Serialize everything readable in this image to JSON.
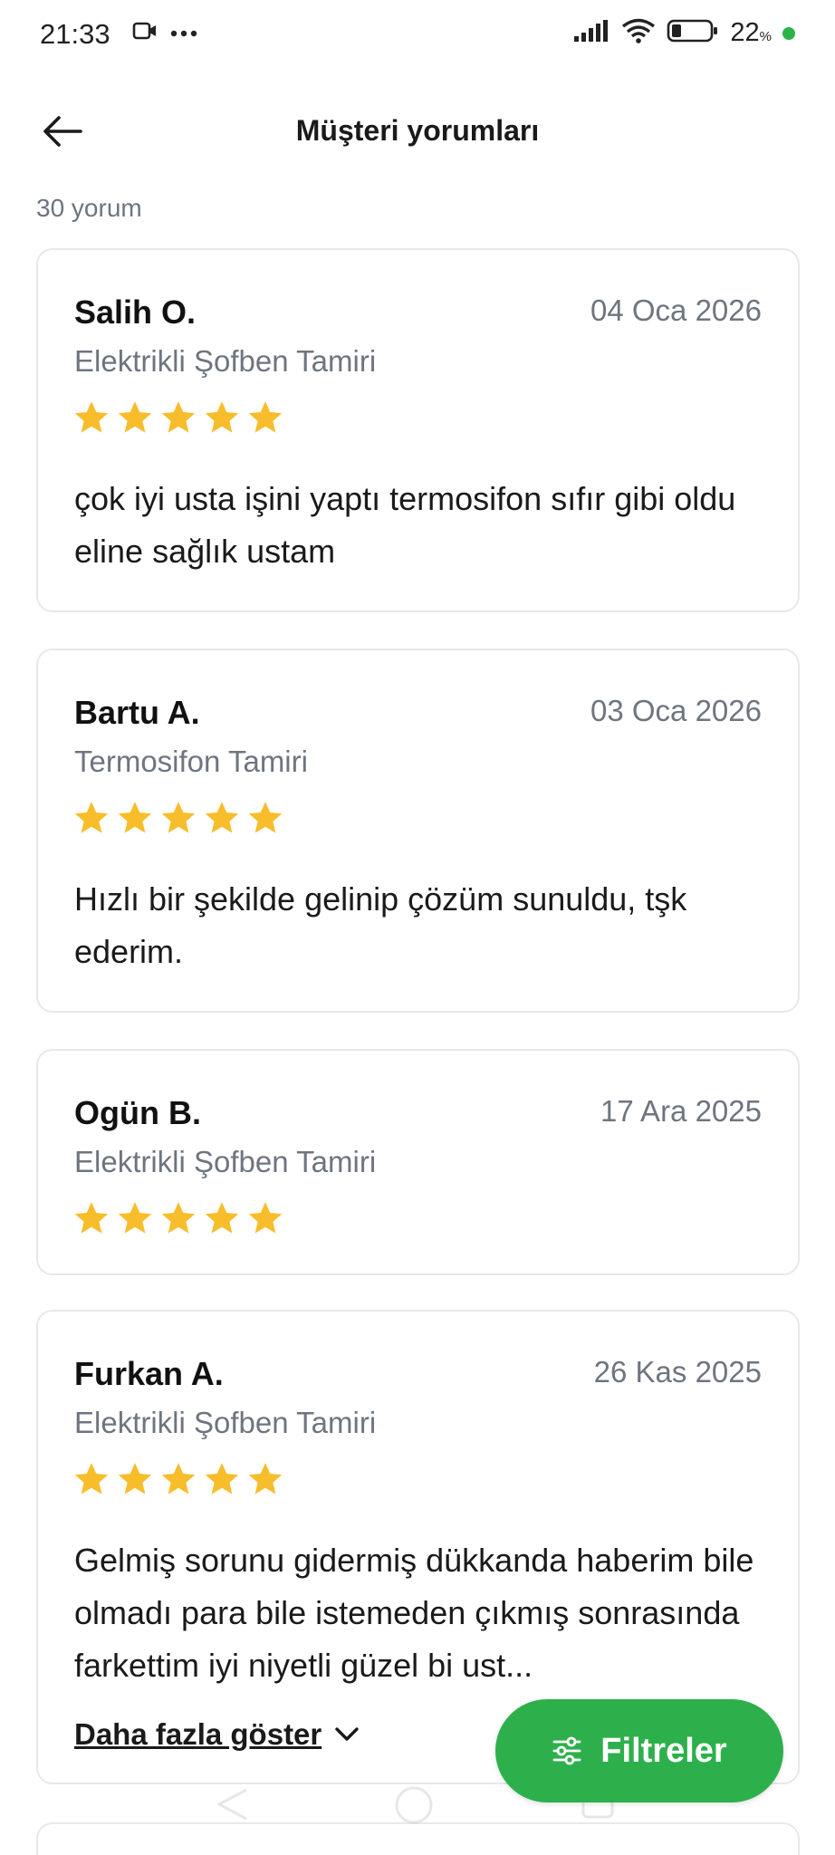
{
  "status_bar": {
    "time": "21:33",
    "battery_percent": "22",
    "battery_unit": "%",
    "battery_level": 0.22
  },
  "header": {
    "title": "Müşteri yorumları"
  },
  "summary": {
    "count_label": "30 yorum"
  },
  "reviews": [
    {
      "name": "Salih O.",
      "date": "04 Oca 2026",
      "service": "Elektrikli Şofben Tamiri",
      "rating": 5,
      "text": "çok iyi usta işini yaptı termosifon sıfır gibi oldu eline sağlık ustam"
    },
    {
      "name": "Bartu A.",
      "date": "03 Oca 2026",
      "service": "Termosifon Tamiri",
      "rating": 5,
      "text": "Hızlı bir şekilde gelinip çözüm sunuldu, tşk ederim."
    },
    {
      "name": "Ogün B.",
      "date": "17 Ara 2025",
      "service": "Elektrikli Şofben Tamiri",
      "rating": 5,
      "text": ""
    },
    {
      "name": "Furkan A.",
      "date": "26 Kas 2025",
      "service": "Elektrikli Şofben Tamiri",
      "rating": 5,
      "text": "Gelmiş sorunu gidermiş dükkanda haberim bile olmadı para bile istemeden çıkmış sonrasında farkettim iyi niyetli güzel bi ust...",
      "more_label": "Daha fazla göster"
    }
  ],
  "filter_button": {
    "label": "Filtreler"
  },
  "colors": {
    "star": "#f7bd2b",
    "accent_green": "#2db04b",
    "muted_text": "#6e7580",
    "card_border": "#e6e8eb"
  },
  "icons": {
    "back": "arrow-left-icon",
    "filter": "sliders-icon",
    "star": "star-icon",
    "chevron": "chevron-down-icon"
  }
}
